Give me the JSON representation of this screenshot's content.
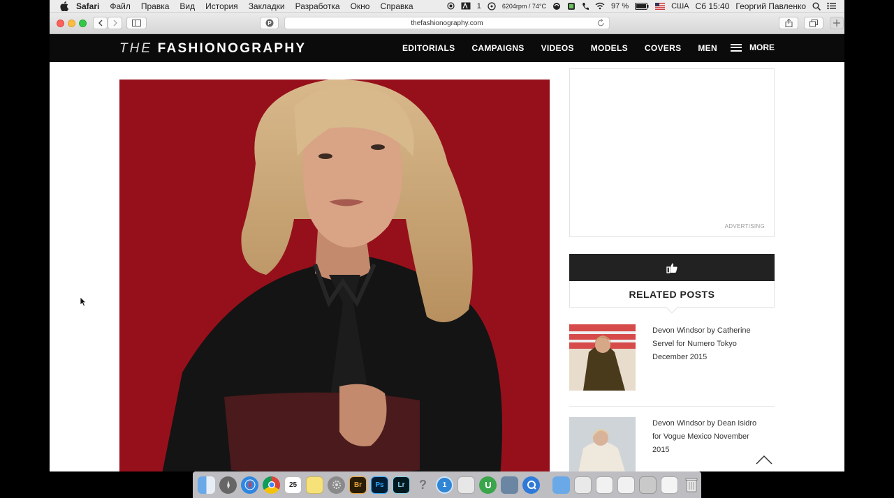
{
  "menubar": {
    "app": "Safari",
    "items": [
      "Файл",
      "Правка",
      "Вид",
      "История",
      "Закладки",
      "Разработка",
      "Окно",
      "Справка"
    ],
    "status": {
      "adobe_count": "1",
      "fan": "6204rpm / 74°C",
      "battery": "97 %",
      "input_source": "США",
      "clock": "Сб 15:40",
      "user": "Георгий Павленко"
    }
  },
  "browser": {
    "url": "thefashionography.com"
  },
  "site": {
    "logo_prefix": "THE",
    "logo_main": "FASHIONOGRAPHY",
    "nav": [
      "EDITORIALS",
      "CAMPAIGNS",
      "VIDEOS",
      "MODELS",
      "COVERS",
      "MEN"
    ],
    "more_label": "MORE"
  },
  "sidebar": {
    "ad_label": "ADVERTISING",
    "related_heading": "RELATED POSTS",
    "posts": [
      {
        "title": "Devon Windsor by Catherine Servel for Numero Tokyo December 2015"
      },
      {
        "title": "Devon Windsor by Dean Isidro for Vogue Mexico November 2015"
      }
    ]
  },
  "dock": {
    "calendar_day": "25",
    "bridge_label": "Br",
    "photoshop_label": "Ps",
    "lightroom_label": "Lr",
    "onepassword_label": "1"
  },
  "colors": {
    "hero_background": "#8d0f1a",
    "header_background": "#0b0b0b",
    "like_bar": "#222222"
  }
}
